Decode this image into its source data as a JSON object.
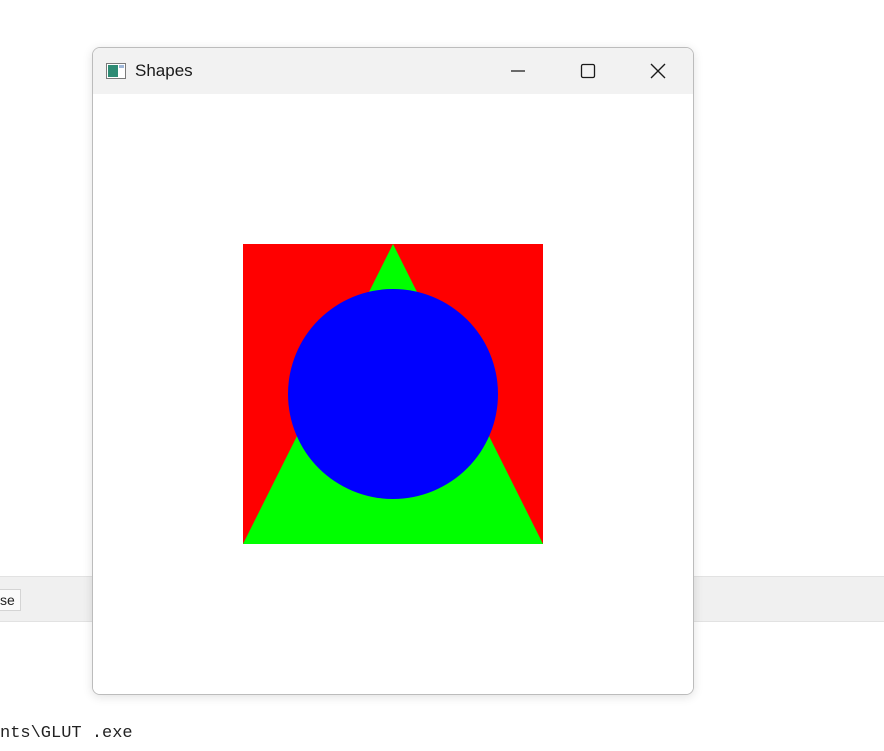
{
  "background": {
    "tab_label": "se",
    "console_line": "nts\\GLUT .exe"
  },
  "window": {
    "title": "Shapes",
    "controls": {
      "minimize": "minimize-icon",
      "maximize": "maximize-icon",
      "close": "close-icon"
    }
  },
  "scene": {
    "shapes": [
      {
        "name": "square",
        "color": "#ff0000"
      },
      {
        "name": "triangle",
        "color": "#00ff00"
      },
      {
        "name": "circle",
        "color": "#0000ff"
      }
    ]
  }
}
